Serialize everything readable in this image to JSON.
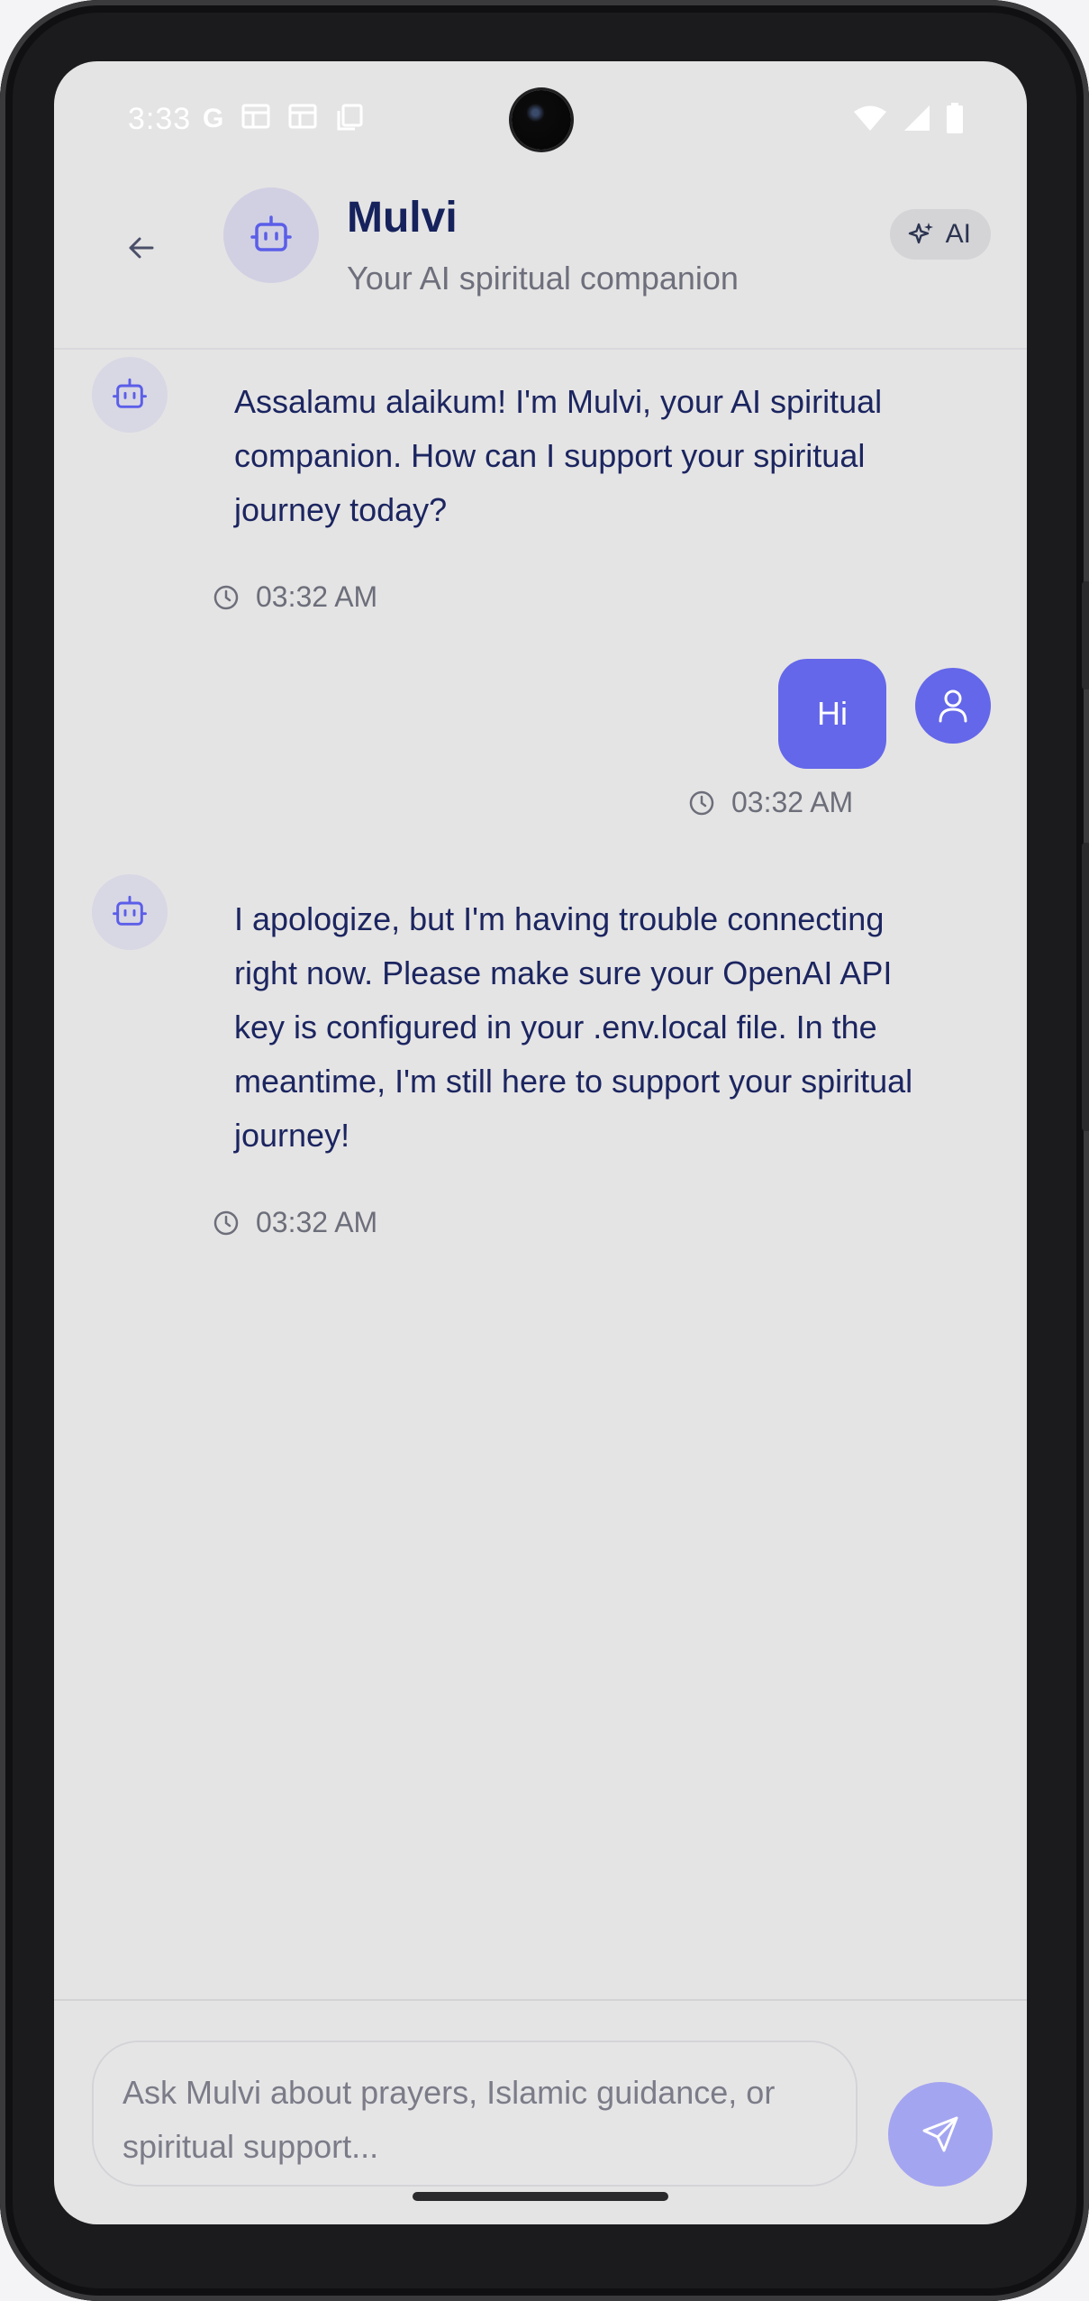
{
  "status_bar": {
    "time": "3:33",
    "left_icons": [
      "google-icon",
      "news-icon",
      "calendar-icon",
      "copy-icon"
    ],
    "right_icons": [
      "wifi-icon",
      "signal-icon",
      "battery-icon"
    ]
  },
  "header": {
    "back_icon": "arrow-left-icon",
    "avatar_icon": "robot-icon",
    "title": "Mulvi",
    "subtitle": "Your AI spiritual companion",
    "badge_icon": "sparkles-icon",
    "badge_label": "AI"
  },
  "messages": [
    {
      "sender": "bot",
      "text": "Assalamu alaikum! I'm Mulvi, your AI spiritual companion. How can I support your spiritual journey today?",
      "time": "03:32 AM"
    },
    {
      "sender": "user",
      "text": "Hi",
      "time": "03:32 AM"
    },
    {
      "sender": "bot",
      "text": "I apologize, but I'm having trouble connecting right now. Please make sure your OpenAI API key is configured in your .env.local file. In the meantime, I'm still here to support your spiritual journey!",
      "time": "03:32 AM"
    }
  ],
  "composer": {
    "placeholder": "Ask Mulvi about prayers, Islamic guidance, or spiritual support...",
    "send_icon": "send-icon"
  },
  "colors": {
    "accent": "#6467e9",
    "send_disabled": "#a4a5f1",
    "title_text": "#16225c",
    "screen_bg": "#e5e4e4"
  }
}
